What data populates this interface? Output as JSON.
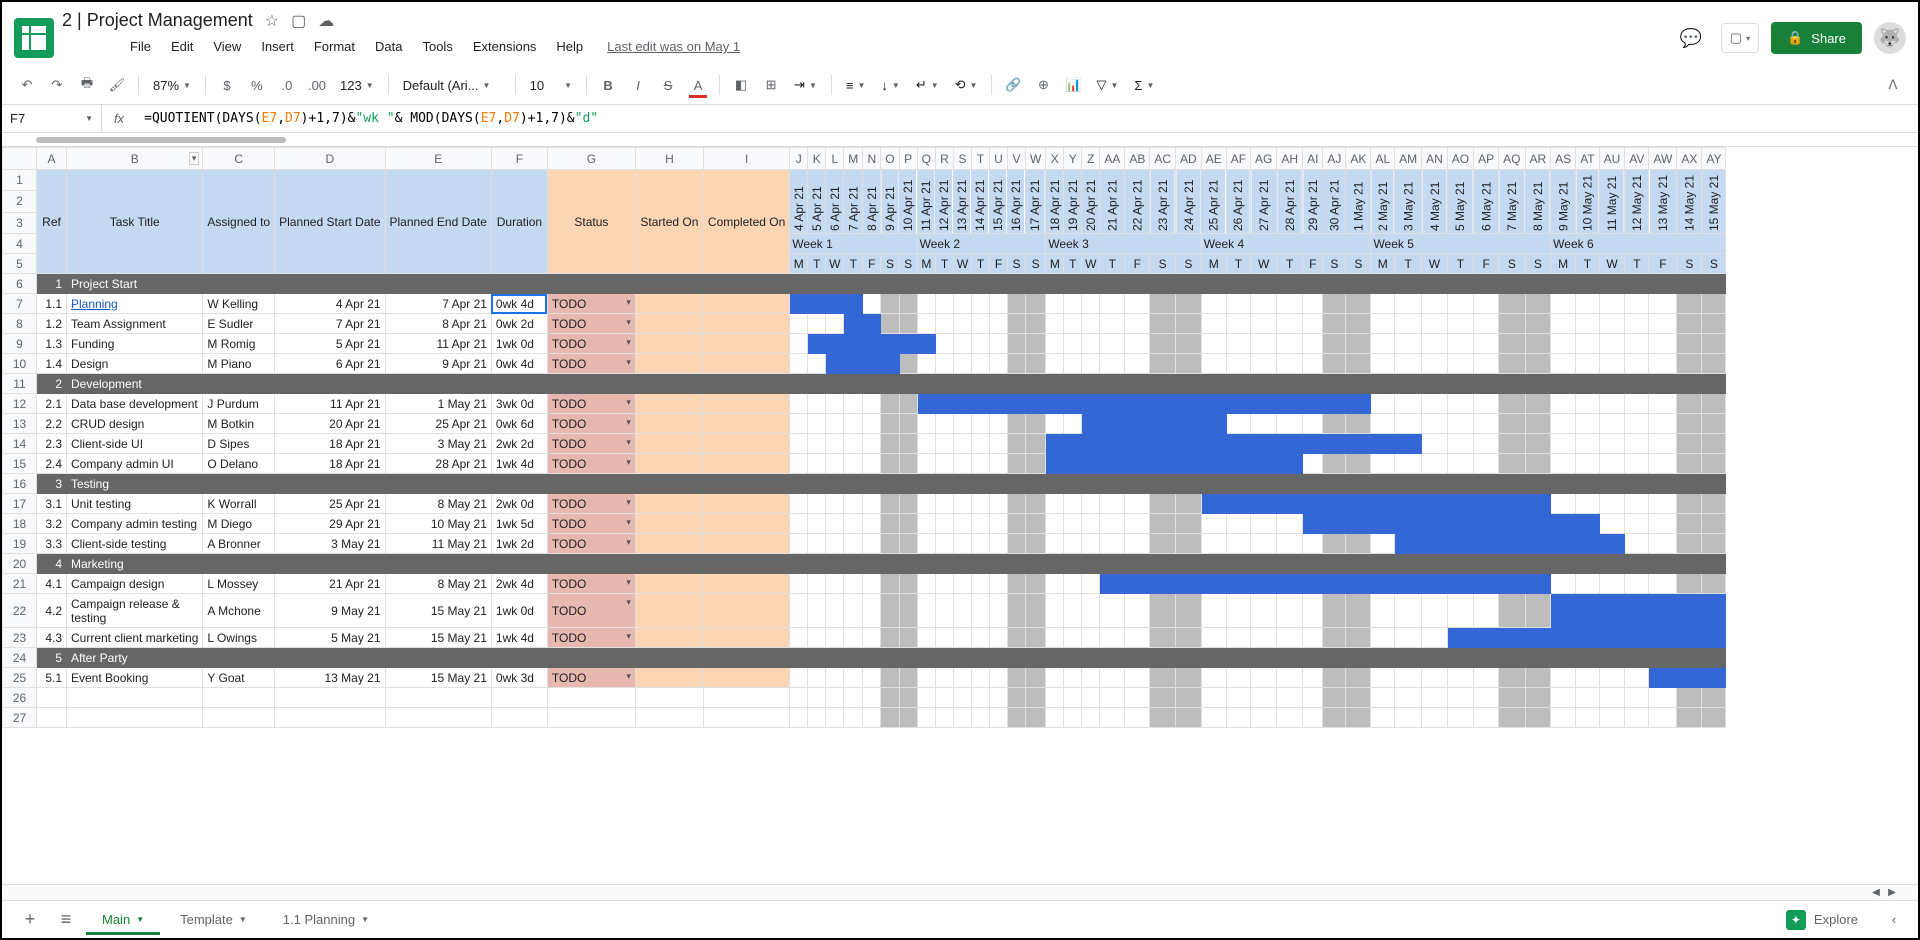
{
  "doc": {
    "title": "2 | Project Management",
    "last_edit": "Last edit was on May 1"
  },
  "menu": [
    "File",
    "Edit",
    "View",
    "Insert",
    "Format",
    "Data",
    "Tools",
    "Extensions",
    "Help"
  ],
  "toolbar": {
    "zoom": "87%",
    "font": "Default (Ari...",
    "size": "10"
  },
  "share_label": "Share",
  "name_box": "F7",
  "formula_raw": "=QUOTIENT(DAYS(E7,D7)+1,7)&\"wk \"& MOD(DAYS(E7,D7)+1,7)&\"d\"",
  "col_headers": [
    "A",
    "B",
    "C",
    "D",
    "E",
    "F",
    "G",
    "H",
    "I",
    "J",
    "K",
    "L",
    "M",
    "N",
    "O",
    "P",
    "Q",
    "R",
    "S",
    "T",
    "U",
    "V",
    "W",
    "X",
    "Y",
    "Z",
    "AA",
    "AB",
    "AC",
    "AD",
    "AE",
    "AF",
    "AG",
    "AH",
    "AI",
    "AJ",
    "AK",
    "AL",
    "AM",
    "AN",
    "AO",
    "AP",
    "AQ",
    "AR",
    "AS",
    "AT",
    "AU",
    "AV",
    "AW",
    "AX",
    "AY"
  ],
  "task_headers": {
    "ref": "Ref",
    "title": "Task Title",
    "assigned": "Assigned to",
    "pstart": "Planned Start Date",
    "pend": "Planned End Date",
    "dur": "Duration",
    "status": "Status",
    "started": "Started On",
    "completed": "Completed On"
  },
  "dates": [
    "4 Apr 21",
    "5 Apr 21",
    "6 Apr 21",
    "7 Apr 21",
    "8 Apr 21",
    "9 Apr 21",
    "10 Apr 21",
    "11 Apr 21",
    "12 Apr 21",
    "13 Apr 21",
    "14 Apr 21",
    "15 Apr 21",
    "16 Apr 21",
    "17 Apr 21",
    "18 Apr 21",
    "19 Apr 21",
    "20 Apr 21",
    "21 Apr 21",
    "22 Apr 21",
    "23 Apr 21",
    "24 Apr 21",
    "25 Apr 21",
    "26 Apr 21",
    "27 Apr 21",
    "28 Apr 21",
    "29 Apr 21",
    "30 Apr 21",
    "1 May 21",
    "2 May 21",
    "3 May 21",
    "4 May 21",
    "5 May 21",
    "6 May 21",
    "7 May 21",
    "8 May 21",
    "9 May 21",
    "10 May 21",
    "11 May 21",
    "12 May 21",
    "13 May 21",
    "14 May 21",
    "15 May 21"
  ],
  "weeks": [
    "Week 1",
    "Week 2",
    "Week 3",
    "Week 4",
    "Week 5",
    "Week 6"
  ],
  "dow": [
    "M",
    "T",
    "W",
    "T",
    "F",
    "S",
    "S"
  ],
  "weekend_cols": [
    5,
    6,
    12,
    13,
    19,
    20,
    26,
    27,
    33,
    34,
    40,
    41
  ],
  "rows": [
    {
      "type": "section",
      "num": "1",
      "title": "Project Start"
    },
    {
      "type": "task",
      "ref": "1.1",
      "title": "Planning",
      "link": true,
      "assigned": "W Kelling",
      "pstart": "4 Apr 21",
      "pend": "7 Apr 21",
      "dur": "0wk 4d",
      "status": "TODO",
      "selected": true,
      "gantt": [
        0,
        3
      ]
    },
    {
      "type": "task",
      "ref": "1.2",
      "title": "Team Assignment",
      "assigned": "E Sudler",
      "pstart": "7 Apr 21",
      "pend": "8 Apr 21",
      "dur": "0wk 2d",
      "status": "TODO",
      "gantt": [
        3,
        4
      ]
    },
    {
      "type": "task",
      "ref": "1.3",
      "title": "Funding",
      "assigned": "M Romig",
      "pstart": "5 Apr 21",
      "pend": "11 Apr 21",
      "dur": "1wk 0d",
      "status": "TODO",
      "gantt": [
        1,
        7
      ]
    },
    {
      "type": "task",
      "ref": "1.4",
      "title": "Design",
      "assigned": "M Piano",
      "pstart": "6 Apr 21",
      "pend": "9 Apr 21",
      "dur": "0wk 4d",
      "status": "TODO",
      "gantt": [
        2,
        5
      ]
    },
    {
      "type": "section",
      "num": "2",
      "title": "Development"
    },
    {
      "type": "task",
      "ref": "2.1",
      "title": "Data base development",
      "assigned": "J Purdum",
      "pstart": "11 Apr 21",
      "pend": "1 May 21",
      "dur": "3wk 0d",
      "status": "TODO",
      "gantt": [
        7,
        27
      ]
    },
    {
      "type": "task",
      "ref": "2.2",
      "title": "CRUD design",
      "assigned": "M Botkin",
      "pstart": "20 Apr 21",
      "pend": "25 Apr 21",
      "dur": "0wk 6d",
      "status": "TODO",
      "gantt": [
        16,
        21
      ]
    },
    {
      "type": "task",
      "ref": "2.3",
      "title": "Client-side UI",
      "assigned": "D Sipes",
      "pstart": "18 Apr 21",
      "pend": "3 May 21",
      "dur": "2wk 2d",
      "status": "TODO",
      "gantt": [
        14,
        29
      ]
    },
    {
      "type": "task",
      "ref": "2.4",
      "title": "Company admin UI",
      "assigned": "O Delano",
      "pstart": "18 Apr 21",
      "pend": "28 Apr 21",
      "dur": "1wk 4d",
      "status": "TODO",
      "gantt": [
        14,
        24
      ]
    },
    {
      "type": "section",
      "num": "3",
      "title": "Testing"
    },
    {
      "type": "task",
      "ref": "3.1",
      "title": "Unit testing",
      "assigned": "K Worrall",
      "pstart": "25 Apr 21",
      "pend": "8 May 21",
      "dur": "2wk 0d",
      "status": "TODO",
      "gantt": [
        21,
        34
      ]
    },
    {
      "type": "task",
      "ref": "3.2",
      "title": "Company admin testing",
      "assigned": "M Diego",
      "pstart": "29 Apr 21",
      "pend": "10 May 21",
      "dur": "1wk 5d",
      "status": "TODO",
      "gantt": [
        25,
        36
      ]
    },
    {
      "type": "task",
      "ref": "3.3",
      "title": "Client-side testing",
      "assigned": "A Bronner",
      "pstart": "3 May 21",
      "pend": "11 May 21",
      "dur": "1wk 2d",
      "status": "TODO",
      "gantt": [
        29,
        37
      ]
    },
    {
      "type": "section",
      "num": "4",
      "title": "Marketing"
    },
    {
      "type": "task",
      "ref": "4.1",
      "title": "Campaign design",
      "assigned": "L Mossey",
      "pstart": "21 Apr 21",
      "pend": "8 May 21",
      "dur": "2wk 4d",
      "status": "TODO",
      "gantt": [
        17,
        34
      ]
    },
    {
      "type": "task",
      "ref": "4.2",
      "title": "Campaign release & testing",
      "assigned": "A Mchone",
      "pstart": "9 May 21",
      "pend": "15 May 21",
      "dur": "1wk 0d",
      "status": "TODO",
      "tall": true,
      "gantt": [
        35,
        41
      ]
    },
    {
      "type": "task",
      "ref": "4.3",
      "title": "Current client marketing",
      "assigned": "L Owings",
      "pstart": "5 May 21",
      "pend": "15 May 21",
      "dur": "1wk 4d",
      "status": "TODO",
      "gantt": [
        31,
        41
      ]
    },
    {
      "type": "section",
      "num": "5",
      "title": "After Party"
    },
    {
      "type": "task",
      "ref": "5.1",
      "title": "Event Booking",
      "assigned": "Y Goat",
      "pstart": "13 May 21",
      "pend": "15 May 21",
      "dur": "0wk 3d",
      "status": "TODO",
      "gantt": [
        39,
        41
      ]
    },
    {
      "type": "empty"
    },
    {
      "type": "empty"
    }
  ],
  "tabs": [
    {
      "label": "Main",
      "active": true
    },
    {
      "label": "Template",
      "active": false
    },
    {
      "label": "1.1 Planning",
      "active": false
    }
  ],
  "explore_label": "Explore"
}
